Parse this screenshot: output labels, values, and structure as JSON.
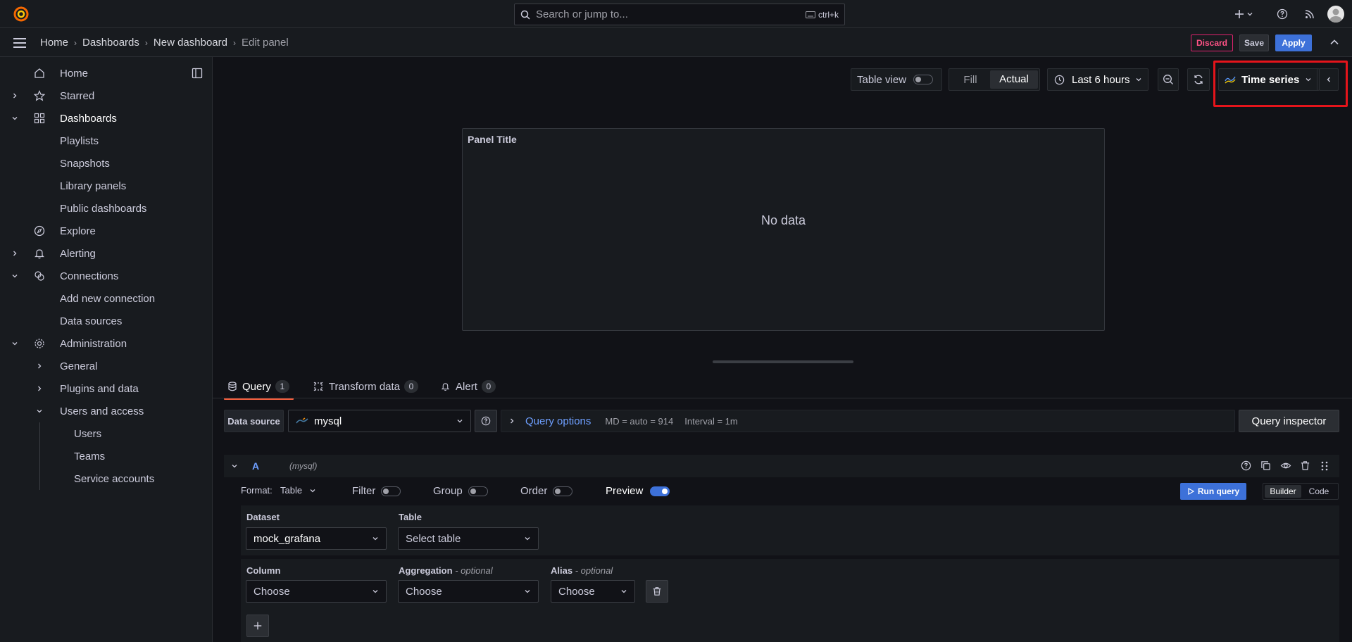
{
  "topbar": {
    "search_placeholder": "Search or jump to...",
    "search_shortcut": "ctrl+k"
  },
  "breadcrumb": [
    "Home",
    "Dashboards",
    "New dashboard",
    "Edit panel"
  ],
  "header_actions": {
    "discard": "Discard",
    "save": "Save",
    "apply": "Apply"
  },
  "sidebar": {
    "home": "Home",
    "starred": "Starred",
    "dashboards": "Dashboards",
    "playlists": "Playlists",
    "snapshots": "Snapshots",
    "library_panels": "Library panels",
    "public_dashboards": "Public dashboards",
    "explore": "Explore",
    "alerting": "Alerting",
    "connections": "Connections",
    "add_new_connection": "Add new connection",
    "data_sources": "Data sources",
    "administration": "Administration",
    "general": "General",
    "plugins_and_data": "Plugins and data",
    "users_and_access": "Users and access",
    "users": "Users",
    "teams": "Teams",
    "service_accounts": "Service accounts"
  },
  "toolbar": {
    "table_view": "Table view",
    "fill": "Fill",
    "actual": "Actual",
    "time_range": "Last 6 hours",
    "visualization": "Time series"
  },
  "panel": {
    "title": "Panel Title",
    "empty": "No data"
  },
  "tabs": [
    {
      "label": "Query",
      "count": "1"
    },
    {
      "label": "Transform data",
      "count": "0"
    },
    {
      "label": "Alert",
      "count": "0"
    }
  ],
  "query_bar": {
    "data_source_label": "Data source",
    "data_source_value": "mysql",
    "query_options": "Query options",
    "md": "MD = auto = 914",
    "interval": "Interval = 1m",
    "inspector": "Query inspector"
  },
  "query_a": {
    "ref": "A",
    "ds": "(mysql)",
    "format_label": "Format:",
    "format_value": "Table",
    "filter": "Filter",
    "group": "Group",
    "order": "Order",
    "preview": "Preview",
    "run_query": "Run query",
    "builder": "Builder",
    "code": "Code",
    "dataset_label": "Dataset",
    "dataset_value": "mock_grafana",
    "table_label": "Table",
    "table_placeholder": "Select table",
    "column_label": "Column",
    "column_value": "Choose",
    "aggregation_label": "Aggregation",
    "aggregation_optional": "- optional",
    "aggregation_value": "Choose",
    "alias_label": "Alias",
    "alias_optional": "- optional",
    "alias_value": "Choose"
  }
}
